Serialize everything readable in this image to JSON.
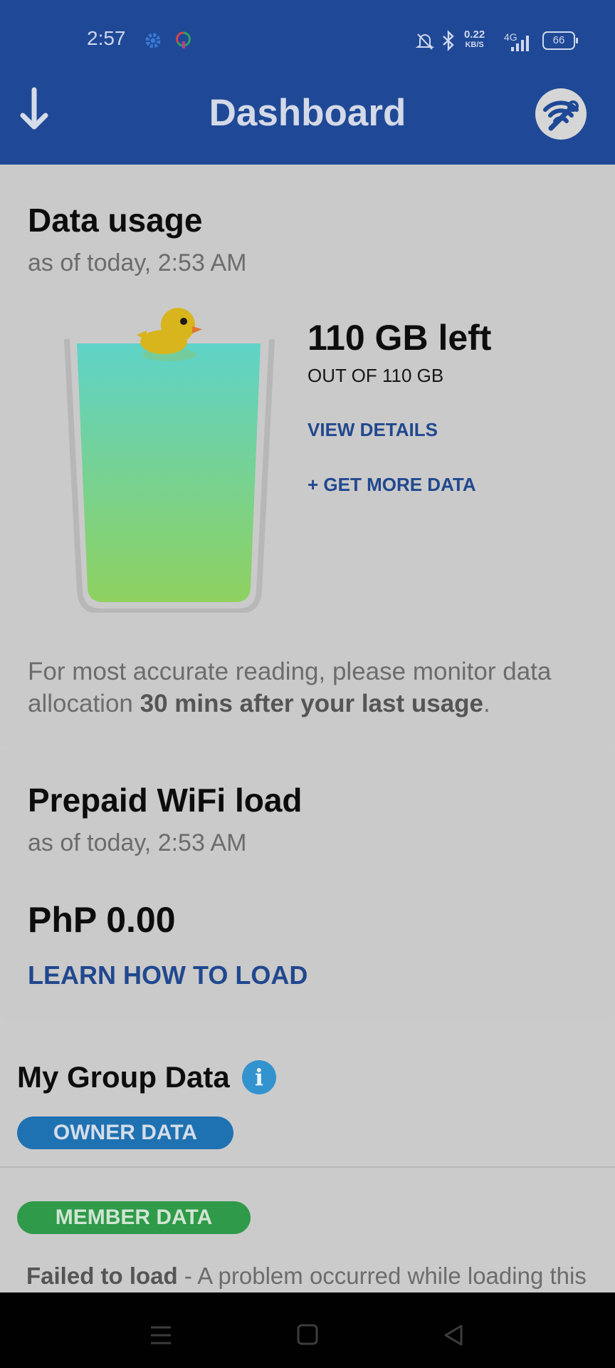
{
  "status_bar": {
    "time": "2:57",
    "speed_value": "0.22",
    "speed_unit": "KB/S",
    "network": "4G",
    "battery": "66",
    "icons": [
      "settings-gear-icon",
      "app-notification-icon",
      "bell-muted-icon",
      "bluetooth-icon",
      "signal-icon",
      "battery-icon"
    ]
  },
  "header": {
    "title": "Dashboard",
    "left_icon": "download-arrow-icon",
    "right_icon": "wifi-tools-icon",
    "color": "#1f4996"
  },
  "data_usage": {
    "title": "Data usage",
    "as_of": "as of today, 2:53 AM",
    "left": "110 GB left",
    "out_of": "OUT OF 110 GB",
    "view_details": "VIEW DETAILS",
    "get_more": "+ GET MORE DATA",
    "remaining_fraction": 1.0,
    "note_start": "For most accurate reading, please monitor data allocation ",
    "note_bold": "30 mins after your last usage",
    "note_end": "."
  },
  "prepaid": {
    "title": "Prepaid WiFi load",
    "as_of": "as of today, 2:53 AM",
    "balance": "PhP 0.00",
    "learn": "LEARN HOW TO LOAD"
  },
  "group": {
    "title": "My Group Data",
    "info_glyph": "i",
    "owner_label": "OWNER DATA",
    "member_label": "MEMBER DATA",
    "fail_bold": "Failed to load",
    "fail_text": " - A problem occurred while loading this"
  },
  "colors": {
    "accent_link": "#21488f",
    "owner_pill": "#1f72b2",
    "member_pill": "#2f9a49"
  }
}
